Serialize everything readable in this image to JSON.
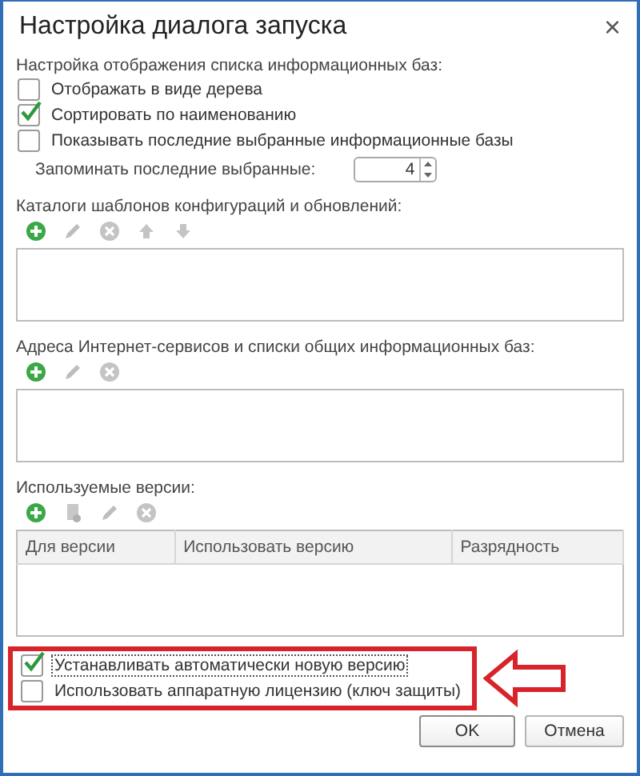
{
  "window": {
    "title": "Настройка диалога запуска",
    "close": "×"
  },
  "list_display": {
    "label": "Настройка отображения списка информационных баз:",
    "options": [
      {
        "label": "Отображать в виде дерева",
        "checked": false
      },
      {
        "label": "Сортировать по наименованию",
        "checked": true
      },
      {
        "label": "Показывать последние выбранные информационные базы",
        "checked": false
      }
    ],
    "remember": {
      "label": "Запоминать последние выбранные:",
      "value": "4"
    }
  },
  "templates": {
    "label": "Каталоги шаблонов конфигураций и обновлений:",
    "toolbar": [
      {
        "kind": "add",
        "disabled": false
      },
      {
        "kind": "edit",
        "disabled": true
      },
      {
        "kind": "delete",
        "disabled": true
      },
      {
        "kind": "up",
        "disabled": true
      },
      {
        "kind": "down",
        "disabled": true
      }
    ]
  },
  "services": {
    "label": "Адреса Интернет-сервисов и списки общих информационных баз:",
    "toolbar": [
      {
        "kind": "add",
        "disabled": false
      },
      {
        "kind": "edit",
        "disabled": true
      },
      {
        "kind": "delete",
        "disabled": true
      }
    ]
  },
  "versions": {
    "label": "Используемые версии:",
    "toolbar": [
      {
        "kind": "add",
        "disabled": false
      },
      {
        "kind": "copy",
        "disabled": true
      },
      {
        "kind": "edit",
        "disabled": true
      },
      {
        "kind": "delete",
        "disabled": true
      }
    ],
    "columns": [
      "Для версии",
      "Использовать версию",
      "Разрядность"
    ]
  },
  "bottom_options": [
    {
      "label": "Устанавливать автоматически новую версию",
      "checked": true,
      "focused": true
    },
    {
      "label": "Использовать аппаратную лицензию (ключ защиты)",
      "checked": false,
      "focused": false
    }
  ],
  "buttons": [
    {
      "label": "OK",
      "default": true
    },
    {
      "label": "Отмена",
      "default": false
    }
  ]
}
